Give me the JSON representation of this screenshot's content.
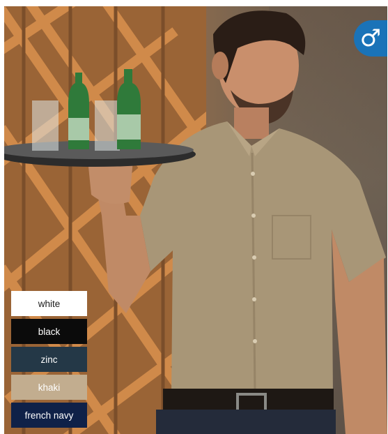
{
  "badge": {
    "icon": "male-symbol-icon",
    "glyph": "♂",
    "color": "#1a73b8"
  },
  "swatches": [
    {
      "label": "white",
      "color": "#ffffff"
    },
    {
      "label": "black",
      "color": "#0b0b0b"
    },
    {
      "label": "zinc",
      "color": "#243847"
    },
    {
      "label": "khaki",
      "color": "#c2ad8f"
    },
    {
      "label": "french navy",
      "color": "#0f2148"
    }
  ]
}
